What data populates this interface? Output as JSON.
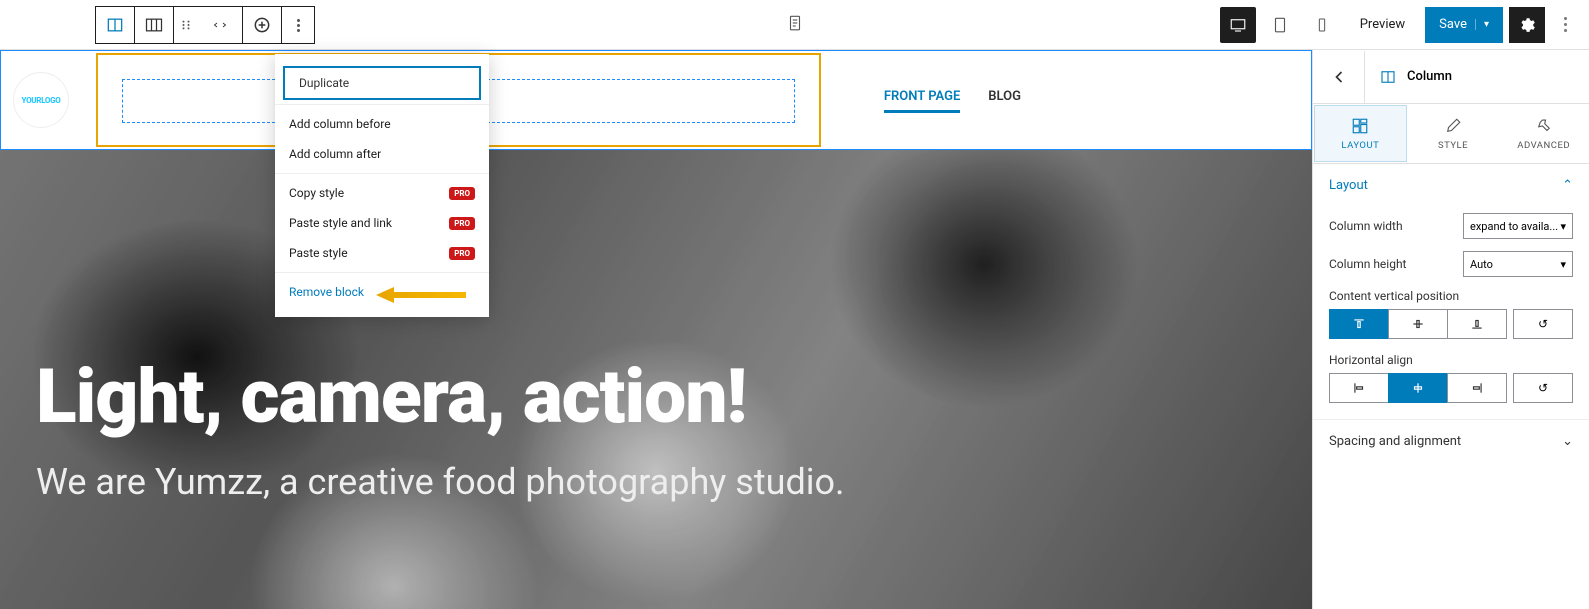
{
  "toolbar": {
    "doc_icon": "document"
  },
  "topbar_right": {
    "preview": "Preview",
    "save": "Save"
  },
  "logo": "YOURLOGO",
  "nav": {
    "front_page": "FRONT PAGE",
    "blog": "BLOG"
  },
  "hero": {
    "title": "Light, camera, action!",
    "subtitle": "We are Yumzz, a creative food photography studio."
  },
  "dropdown": {
    "duplicate": "Duplicate",
    "add_before": "Add column before",
    "add_after": "Add column after",
    "copy_style": "Copy style",
    "paste_style_link": "Paste style and link",
    "paste_style": "Paste style",
    "remove": "Remove block",
    "pro": "PRO"
  },
  "sidebar": {
    "title": "Column",
    "tabs": {
      "layout": "LAYOUT",
      "style": "STYLE",
      "advanced": "ADVANCED"
    },
    "panel": {
      "layout": "Layout",
      "col_width": "Column width",
      "col_width_val": "expand to availa...",
      "col_height": "Column height",
      "col_height_val": "Auto",
      "content_vpos": "Content vertical position",
      "h_align": "Horizontal align",
      "spacing": "Spacing and alignment"
    }
  }
}
